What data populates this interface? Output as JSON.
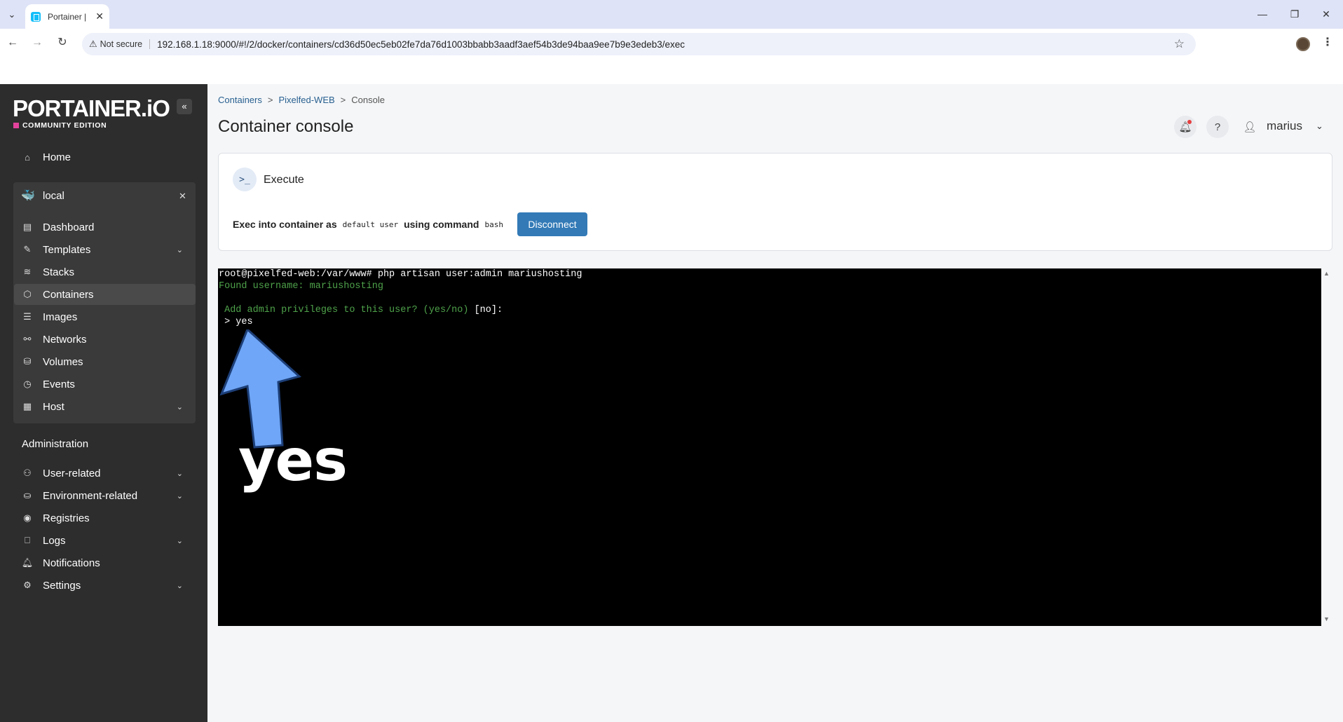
{
  "browser": {
    "tab_title": "Portainer |",
    "not_secure": "Not secure",
    "url": "192.168.1.18:9000/#!/2/docker/containers/cd36d50ec5eb02fe7da76d1003bbabb3aadf3aef54b3de94baa9ee7b9e3edeb3/exec"
  },
  "sidebar": {
    "logo": "PORTAINER.iO",
    "edition": "COMMUNITY EDITION",
    "home_label": "Home",
    "environment": {
      "name": "local",
      "items": [
        {
          "label": "Dashboard",
          "icon": "dashboard-icon"
        },
        {
          "label": "Templates",
          "icon": "templates-icon"
        },
        {
          "label": "Stacks",
          "icon": "stacks-icon"
        },
        {
          "label": "Containers",
          "icon": "containers-icon"
        },
        {
          "label": "Images",
          "icon": "images-icon"
        },
        {
          "label": "Networks",
          "icon": "networks-icon"
        },
        {
          "label": "Volumes",
          "icon": "volumes-icon"
        },
        {
          "label": "Events",
          "icon": "events-icon"
        },
        {
          "label": "Host",
          "icon": "host-icon"
        }
      ]
    },
    "admin_title": "Administration",
    "admin_items": [
      {
        "label": "User-related"
      },
      {
        "label": "Environment-related"
      },
      {
        "label": "Registries"
      },
      {
        "label": "Logs"
      },
      {
        "label": "Notifications"
      },
      {
        "label": "Settings"
      }
    ]
  },
  "header": {
    "breadcrumb": [
      "Containers",
      "Pixelfed-WEB",
      "Console"
    ],
    "title": "Container console",
    "user": "marius"
  },
  "exec": {
    "title": "Execute",
    "line_prefix": "Exec into container as",
    "user_value": "default user",
    "line_mid": "using command",
    "command_value": "bash",
    "disconnect_label": "Disconnect"
  },
  "terminal": {
    "lines": [
      "root@pixelfed-web:/var/www# php artisan user:admin mariushosting",
      "Found username: mariushosting",
      " Add admin privileges to this user? (yes/no)",
      "[no]:",
      " > yes"
    ]
  },
  "annotation": {
    "text": "yes",
    "arrow_color": "#6fa6f7"
  }
}
